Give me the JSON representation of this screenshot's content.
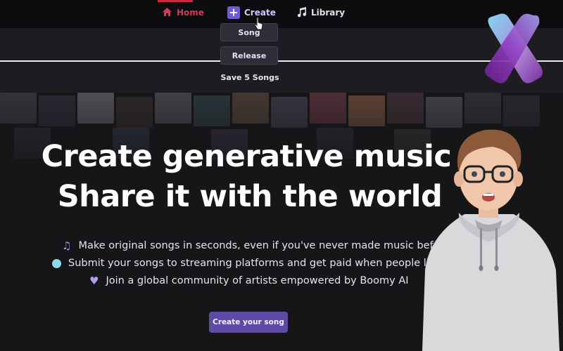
{
  "nav": {
    "home_label": "Home",
    "create_label": "Create",
    "library_label": "Library",
    "icons": [
      "home-icon",
      "plus-icon",
      "music-note-icon"
    ]
  },
  "create_dropdown": {
    "items": [
      "Song",
      "Release"
    ],
    "footer": "Save 5 Songs"
  },
  "hero": {
    "title_line1": "Create generative music",
    "title_line2": "Share it with the world"
  },
  "features": [
    {
      "icon": "music-notes-icon",
      "text": "Make original songs in seconds, even if you've never made music befor"
    },
    {
      "icon": "dot-icon",
      "text": "Submit your songs to streaming platforms and get paid when people lis"
    },
    {
      "icon": "heart-icon",
      "text": "Join a global community of artists empowered by Boomy AI"
    }
  ],
  "cta": {
    "label": "Create your song"
  },
  "colors": {
    "accent": "#6f5bd8",
    "home_red": "#d23b57",
    "cta_bg": "#5f4aa6",
    "background": "#161518"
  }
}
